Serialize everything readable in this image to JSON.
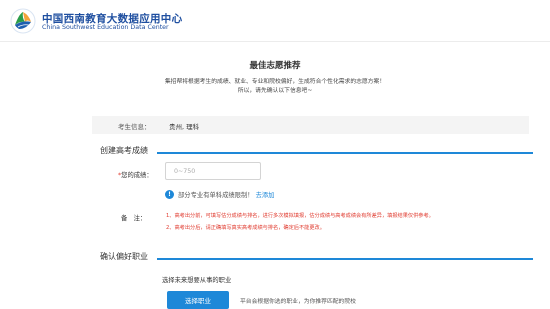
{
  "header": {
    "name_cn": "中国西南教育大数据应用中心",
    "name_en": "China Southwest Education Data Center"
  },
  "page": {
    "title": "最佳志愿推荐",
    "intro_line1": "集招帮将根据考生的成绩、就业、专业和院校偏好，生成符合个性化需求的志愿方案！",
    "intro_line2": "所以，请先确认以下信息吧~"
  },
  "student_info": {
    "label": "考生信息：",
    "value": "贵州, 理科"
  },
  "score_section": {
    "title": "创建高考成绩",
    "score_label": "您的成绩：",
    "score_placeholder": "0~750",
    "limit_text": "部分专业有单科成绩限制！",
    "add_link": "去添加",
    "note_label": "备　注：",
    "note_1": "1、高考出分前，可填写估分成绩与排名，进行多次模拟填报，估分成绩与高考成绩会有所差异，填报结果仅供参考。",
    "note_2": "2、高考出分后，请正确填写真实高考成绩与排名，确定后不能更改。"
  },
  "career_section": {
    "title": "确认偏好职业",
    "prompt": "选择未来想要从事的职业",
    "button": "选择职业",
    "description": "平台会根据你选的职业，为你推荐匹配的院校"
  },
  "colors": {
    "brand_blue": "#1f4fa0",
    "accent_blue": "#1e88d8",
    "warning_red": "#e03a2e"
  }
}
